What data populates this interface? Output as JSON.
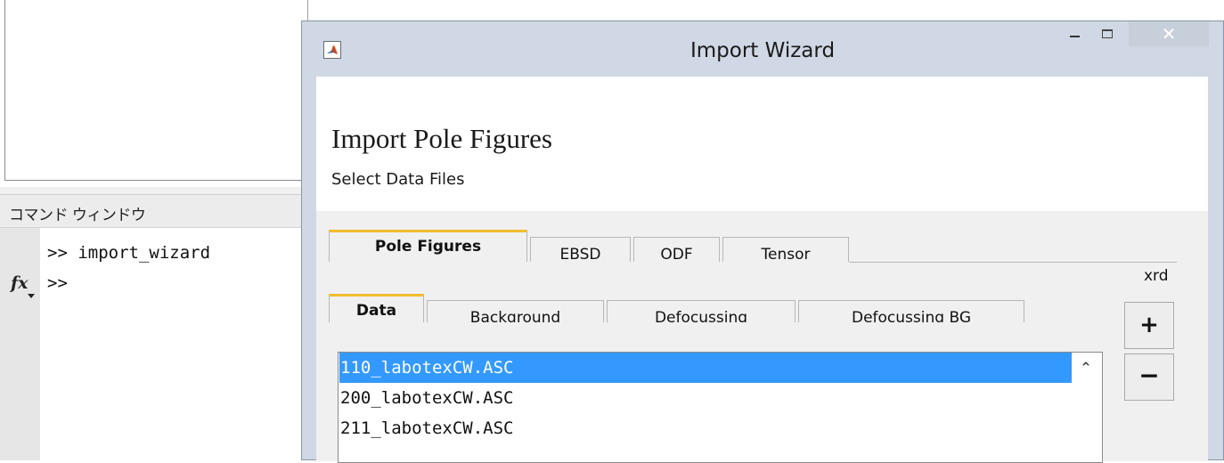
{
  "background": {
    "command_window_title": "コマンド ウィンドウ",
    "history": [
      ">> import_wizard"
    ],
    "prompt": ">>",
    "fx_icon_label": "fx"
  },
  "wizard": {
    "title": "Import Wizard",
    "window_buttons": {
      "minimize": "–",
      "maximize": "☐",
      "close": "✕"
    },
    "page_title": "Import Pole Figures",
    "page_subtitle": "Select Data Files",
    "main_tabs": [
      {
        "label": "Pole Figures",
        "active": true
      },
      {
        "label": "EBSD",
        "active": false
      },
      {
        "label": "ODF",
        "active": false
      },
      {
        "label": "Tensor",
        "active": false
      }
    ],
    "format_label": "xrd",
    "sub_tabs": [
      {
        "label": "Data",
        "active": true
      },
      {
        "label": "Background",
        "active": false
      },
      {
        "label": "Defocussing",
        "active": false
      },
      {
        "label": "Defocussing BG",
        "active": false
      }
    ],
    "files": [
      {
        "name": "110_labotexCW.ASC",
        "selected": true
      },
      {
        "name": "200_labotexCW.ASC",
        "selected": false
      },
      {
        "name": "211_labotexCW.ASC",
        "selected": false
      }
    ],
    "add_button_label": "+",
    "remove_button_label": "−",
    "colors": {
      "title_bar": "#cfd8e4",
      "selection": "#3399ff",
      "active_tab_accent": "#f2bc2f"
    }
  }
}
